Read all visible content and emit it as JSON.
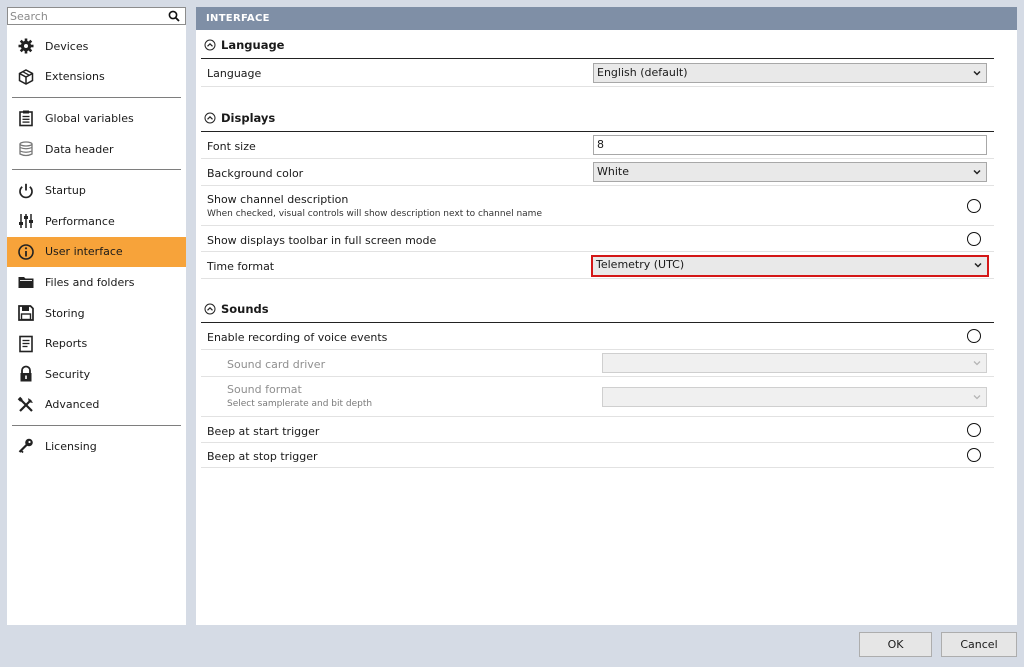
{
  "search": {
    "placeholder": "Search"
  },
  "sidebar": {
    "items": [
      {
        "label": "Devices"
      },
      {
        "label": "Extensions"
      },
      {
        "label": "Global variables"
      },
      {
        "label": "Data header"
      },
      {
        "label": "Startup"
      },
      {
        "label": "Performance"
      },
      {
        "label": "User interface"
      },
      {
        "label": "Files and folders"
      },
      {
        "label": "Storing"
      },
      {
        "label": "Reports"
      },
      {
        "label": "Security"
      },
      {
        "label": "Advanced"
      },
      {
        "label": "Licensing"
      }
    ],
    "active": "User interface"
  },
  "main": {
    "header": "INTERFACE",
    "language": {
      "title": "Language",
      "language_label": "Language",
      "language_value": "English (default)"
    },
    "displays": {
      "title": "Displays",
      "font_size_label": "Font size",
      "font_size_value": "8",
      "bg_color_label": "Background color",
      "bg_color_value": "White",
      "channel_desc_label": "Show channel description",
      "channel_desc_hint": "When checked, visual controls will show description next to channel name",
      "toolbar_label": "Show displays toolbar in full screen mode",
      "time_format_label": "Time format",
      "time_format_value": "Telemetry (UTC)"
    },
    "sounds": {
      "title": "Sounds",
      "voice_label": "Enable recording of voice events",
      "sound_driver_label": "Sound card driver",
      "sound_format_label": "Sound format",
      "sound_format_hint": "Select samplerate and bit depth",
      "beep_start_label": "Beep at start trigger",
      "beep_stop_label": "Beep at stop trigger"
    }
  },
  "footer": {
    "ok_label": "OK",
    "cancel_label": "Cancel"
  },
  "colors": {
    "active_item": "#f7a33a",
    "header_bg": "#7f8fa6",
    "highlight_border": "#d41717",
    "window_bg": "#d5dbe5"
  }
}
